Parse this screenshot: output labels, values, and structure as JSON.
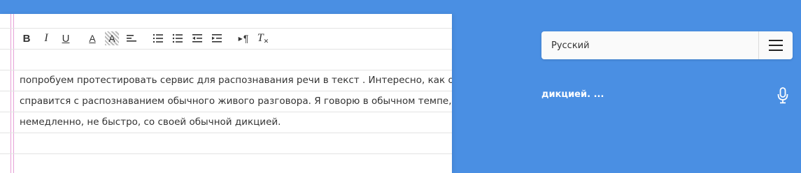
{
  "editor": {
    "toolbar": {
      "bold_label": "B",
      "italic_label": "I",
      "underline_label": "U",
      "text_color_label": "A",
      "bg_color_label": "A",
      "paragraph_label": "¶",
      "clear_format_label": "T"
    },
    "lines": [
      " попробуем протестировать сервис для распознавания речи в текст . Интересно, как он",
      "справится с распознаванием обычного живого разговора. Я говорю в обычном темпе,",
      "немедленно, не быстро, со своей обычной дикцией."
    ],
    "margin_color": "#e6a0d6"
  },
  "panel": {
    "language": "Русский",
    "recognized_text": "дикцией. ...",
    "background_color": "#4a8fe3",
    "icons": {
      "menu": "hamburger-icon",
      "mic": "microphone-icon"
    }
  }
}
